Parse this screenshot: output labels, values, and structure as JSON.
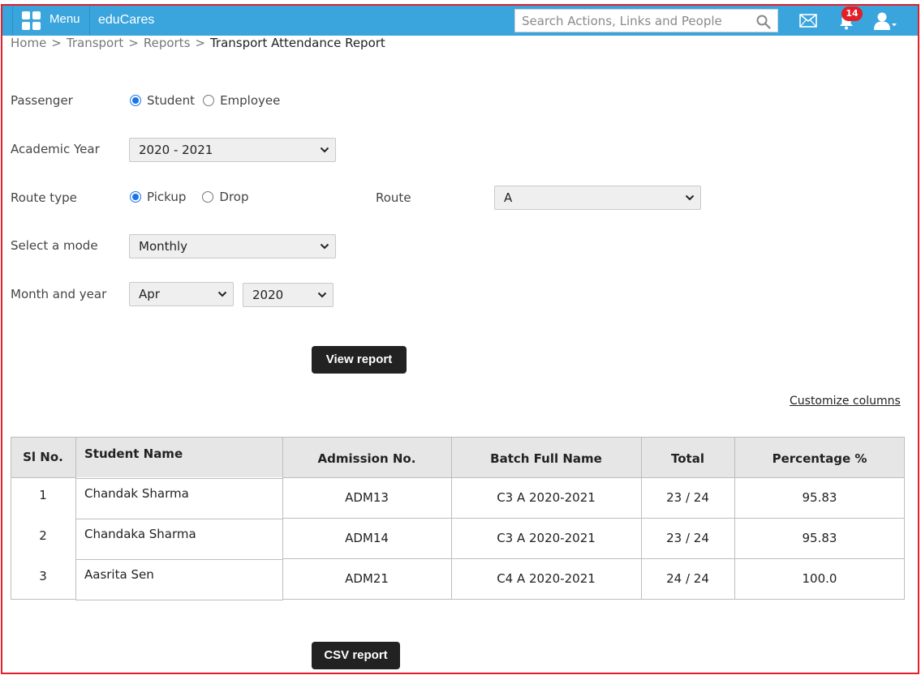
{
  "topbar": {
    "menu_label": "Menu",
    "brand": "eduCares",
    "search_placeholder": "Search Actions, Links and People",
    "notification_count": "14",
    "bar_color": "#3aa5dd",
    "badge_color": "#e31e24"
  },
  "breadcrumb": {
    "items": [
      "Home",
      "Transport",
      "Reports"
    ],
    "separator": ">",
    "current": "Transport Attendance Report"
  },
  "form": {
    "passenger": {
      "label": "Passenger",
      "options": [
        "Student",
        "Employee"
      ],
      "selected": "Student"
    },
    "academic_year": {
      "label": "Academic Year",
      "value": "2020 - 2021"
    },
    "route_type": {
      "label": "Route type",
      "options": [
        "Pickup",
        "Drop"
      ],
      "selected": "Pickup"
    },
    "route": {
      "label": "Route",
      "value": "A"
    },
    "mode": {
      "label": "Select a mode",
      "value": "Monthly"
    },
    "month_year": {
      "label": "Month and year",
      "month": "Apr",
      "year": "2020"
    },
    "view_report_label": "View report"
  },
  "customize_columns_label": "Customize columns",
  "table": {
    "headers": [
      "Sl No.",
      "Student Name",
      "Admission No.",
      "Batch Full Name",
      "Total",
      "Percentage %"
    ],
    "rows": [
      [
        "1",
        "Chandak  Sharma",
        "ADM13",
        "C3 A 2020-2021",
        "23 / 24",
        "95.83"
      ],
      [
        "2",
        "Chandaka  Sharma",
        "ADM14",
        "C3 A 2020-2021",
        "23 / 24",
        "95.83"
      ],
      [
        "3",
        "Aasrita  Sen",
        "ADM21",
        "C4 A 2020-2021",
        "24 / 24",
        "100.0"
      ]
    ]
  },
  "csv_report_label": "CSV report"
}
